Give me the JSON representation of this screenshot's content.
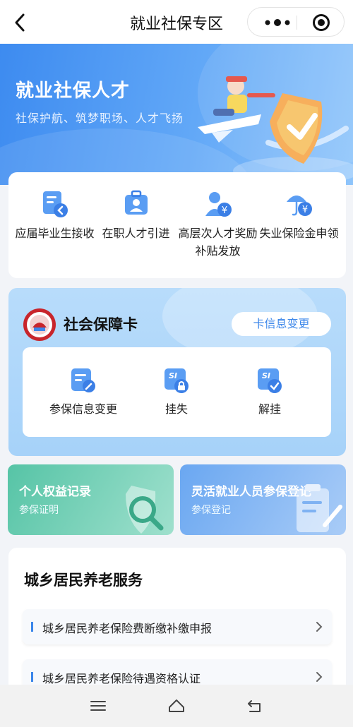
{
  "topbar": {
    "title": "就业社保专区",
    "back_icon": "back-chevron-icon",
    "more_icon": "more-dots-icon",
    "close_icon": "target-circle-icon"
  },
  "banner": {
    "title": "就业社保人才",
    "subtitle": "社保护航、筑梦职场、人才飞扬"
  },
  "services": [
    {
      "label": "应届毕业生接收",
      "icon": "graduate-receive-icon"
    },
    {
      "label": "在职人才引进",
      "icon": "briefcase-icon"
    },
    {
      "label": "高层次人才奖励补贴发放",
      "icon": "talent-subsidy-icon"
    },
    {
      "label": "失业保险金申领",
      "icon": "umbrella-yen-icon"
    }
  ],
  "social_security": {
    "title": "社会保障卡",
    "change_button": "卡信息变更",
    "items": [
      {
        "label": "参保信息变更",
        "icon": "edit-info-icon"
      },
      {
        "label": "挂失",
        "icon": "lock-card-icon"
      },
      {
        "label": "解挂",
        "icon": "unlock-card-icon"
      }
    ]
  },
  "tiles": [
    {
      "title": "个人权益记录",
      "subtitle": "参保证明",
      "color": "#56c4a6"
    },
    {
      "title": "灵活就业人员参保登记",
      "subtitle": "参保登记",
      "color": "#6aa7f1"
    }
  ],
  "pension": {
    "title": "城乡居民养老服务",
    "rows": [
      {
        "label": "城乡居民养老保险费断缴补缴申报"
      },
      {
        "label": "城乡居民养老保险待遇资格认证"
      }
    ]
  },
  "colors": {
    "accent": "#3b86ea",
    "banner": "#3d8bf0"
  }
}
